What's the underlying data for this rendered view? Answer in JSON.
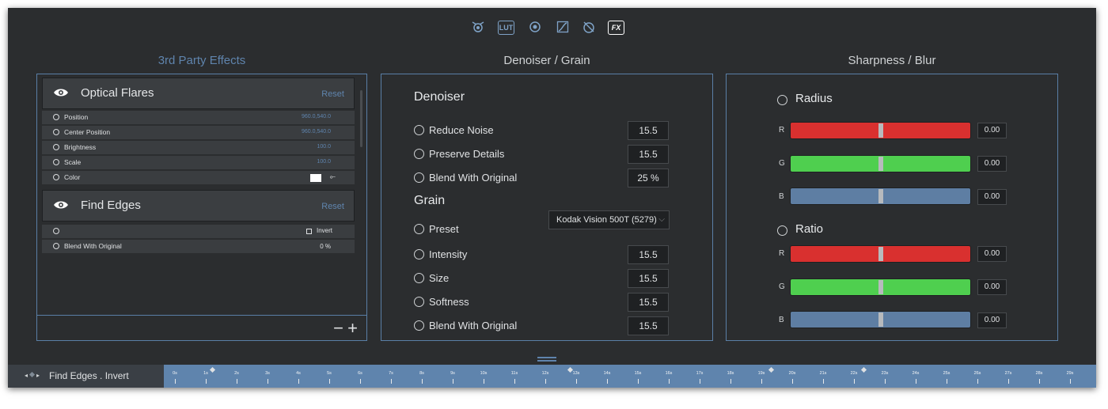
{
  "toolbar": {
    "icons": [
      "camera-icon",
      "lut-icon",
      "target-icon",
      "curve-icon",
      "color-wheel-icon",
      "fx-icon"
    ],
    "lut_label": "LUT",
    "fx_label": "FX"
  },
  "third_party": {
    "title": "3rd Party Effects",
    "effects": [
      {
        "name": "Optical Flares",
        "reset": "Reset",
        "params": [
          {
            "label": "Position",
            "value": "960.0,540.0"
          },
          {
            "label": "Center Position",
            "value": "960.0,540.0"
          },
          {
            "label": "Brightness",
            "value": "100.0"
          },
          {
            "label": "Scale",
            "value": "100.0"
          },
          {
            "label": "Color",
            "value": ""
          }
        ]
      },
      {
        "name": "Find Edges",
        "reset": "Reset",
        "params": [
          {
            "label": "",
            "value": "Invert"
          },
          {
            "label": "Blend With Original",
            "value": "0 %"
          }
        ]
      }
    ],
    "color_swatch": "#ffffff",
    "minus": "−",
    "plus": "+"
  },
  "denoiser_grain": {
    "title": "Denoiser / Grain",
    "denoiser_heading": "Denoiser",
    "denoiser_rows": [
      {
        "label": "Reduce Noise",
        "value": "15.5"
      },
      {
        "label": "Preserve Details",
        "value": "15.5"
      },
      {
        "label": "Blend With Original",
        "value": "25 %"
      }
    ],
    "grain_heading": "Grain",
    "preset_label": "Preset",
    "preset_value": "Kodak Vision 500T (5279)",
    "grain_rows": [
      {
        "label": "Intensity",
        "value": "15.5"
      },
      {
        "label": "Size",
        "value": "15.5"
      },
      {
        "label": "Softness",
        "value": "15.5"
      },
      {
        "label": "Blend With Original",
        "value": "15.5"
      }
    ]
  },
  "sharpness_blur": {
    "title": "Sharpness / Blur",
    "groups": [
      {
        "name": "Radius",
        "channels": [
          {
            "label": "R",
            "value": "0.00",
            "level": 0.5,
            "color": "#d9302f"
          },
          {
            "label": "G",
            "value": "0.00",
            "level": 0.5,
            "color": "#4fcf4f"
          },
          {
            "label": "B",
            "value": "0.00",
            "level": 0.5,
            "color": "#5e7ea3"
          }
        ]
      },
      {
        "name": "Ratio",
        "channels": [
          {
            "label": "R",
            "value": "0.00",
            "level": 0.5,
            "color": "#d9302f"
          },
          {
            "label": "G",
            "value": "0.00",
            "level": 0.5,
            "color": "#4fcf4f"
          },
          {
            "label": "B",
            "value": "0.00",
            "level": 0.5,
            "color": "#5e7ea3"
          }
        ]
      }
    ]
  },
  "bottom_bar": {
    "label": "Find Edges . Invert",
    "prev": "◂",
    "next": "▸",
    "timeline_labels": [
      "0s",
      "1s",
      "2s",
      "3s",
      "4s",
      "5s",
      "6s",
      "7s",
      "8s",
      "9s",
      "10s",
      "11s",
      "12s",
      "13s",
      "14s",
      "15s",
      "16s",
      "17s",
      "18s",
      "19s",
      "20s",
      "21s",
      "22s",
      "23s",
      "24s",
      "25s",
      "26s",
      "27s",
      "28s",
      "29s"
    ],
    "keyframes": [
      1.2,
      12.8,
      19.3,
      22.3
    ]
  },
  "colors": {
    "accent": "#5f84ad",
    "background": "#2b2d2f"
  }
}
